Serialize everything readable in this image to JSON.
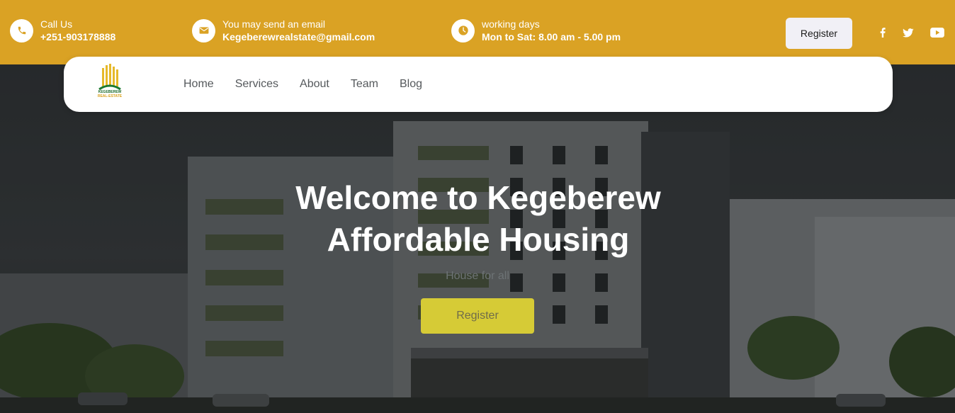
{
  "topbar": {
    "call": {
      "label": "Call Us",
      "value": "+251-903178888",
      "icon": "phone-icon"
    },
    "email": {
      "label": "You may send an email",
      "value": "Kegeberewrealstate@gmail.com",
      "icon": "mail-icon"
    },
    "hours": {
      "label": "working days",
      "value": "Mon to Sat: 8.00 am - 5.00 pm",
      "icon": "clock-icon"
    },
    "register_label": "Register",
    "social": [
      "facebook-icon",
      "twitter-icon",
      "youtube-icon"
    ]
  },
  "nav": {
    "logo_lines": [
      "KEGEBEREW",
      "REAL-ESTATE"
    ],
    "items": [
      {
        "label": "Home"
      },
      {
        "label": "Services"
      },
      {
        "label": "About"
      },
      {
        "label": "Team"
      },
      {
        "label": "Blog"
      }
    ]
  },
  "hero": {
    "title_line1": "Welcome to Kegeberew",
    "title_line2": "Affordable Housing",
    "subtitle": "House for all",
    "button_label": "Register"
  },
  "colors": {
    "topbar": "#daa224",
    "hero_button": "#d6cb36",
    "nav_text": "#55595c"
  }
}
